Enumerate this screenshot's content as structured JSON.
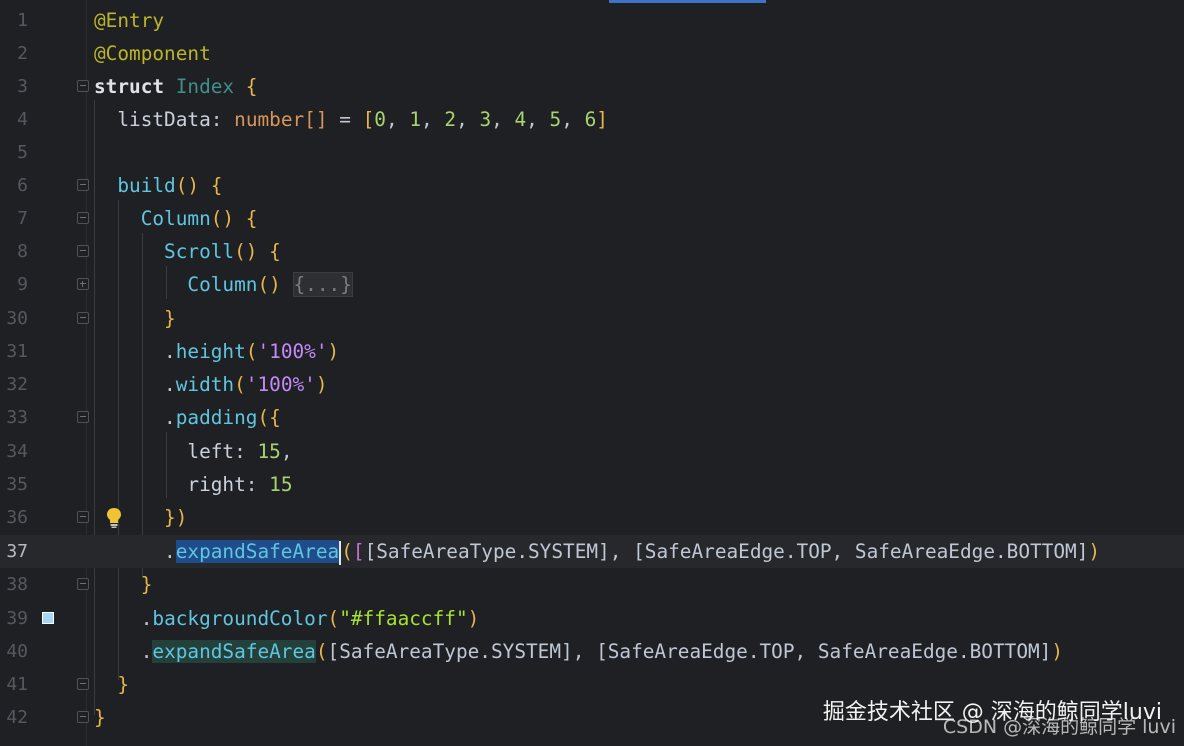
{
  "editor": {
    "accent": "#3d72c8",
    "current_line": "37",
    "lines": [
      {
        "n": "1"
      },
      {
        "n": "2"
      },
      {
        "n": "3"
      },
      {
        "n": "4"
      },
      {
        "n": "5"
      },
      {
        "n": "6"
      },
      {
        "n": "7"
      },
      {
        "n": "8"
      },
      {
        "n": "9"
      },
      {
        "n": "30"
      },
      {
        "n": "31"
      },
      {
        "n": "32"
      },
      {
        "n": "33"
      },
      {
        "n": "34"
      },
      {
        "n": "35"
      },
      {
        "n": "36"
      },
      {
        "n": "37"
      },
      {
        "n": "38"
      },
      {
        "n": "39"
      },
      {
        "n": "40"
      },
      {
        "n": "41"
      },
      {
        "n": "42"
      }
    ],
    "code": {
      "l1": "@Entry",
      "l2": "@Component",
      "l3_kw": "struct",
      "l3_name": "Index",
      "l3_brace": "{",
      "l4_prop": "listData",
      "l4_colon": ":",
      "l4_type": "number[]",
      "l4_eq": "=",
      "l4_open": "[",
      "l4_nums": [
        "0",
        "1",
        "2",
        "3",
        "4",
        "5",
        "6"
      ],
      "l4_close": "]",
      "l6_fn": "build",
      "l6_rest": "() {",
      "l7_fn": "Column",
      "l7_rest": "() {",
      "l8_fn": "Scroll",
      "l8_rest": "() {",
      "l9_fn": "Column",
      "l9_rest": "()",
      "l9_folded": "{...}",
      "l30": "}",
      "l31_dot": ".",
      "l31_fn": "height",
      "l31_arg": "'100%'",
      "l32_dot": ".",
      "l32_fn": "width",
      "l32_arg": "'100%'",
      "l33_dot": ".",
      "l33_fn": "padding",
      "l33_rest": "({",
      "l34_key": "left",
      "l34_val": "15",
      "l35_key": "right",
      "l35_val": "15",
      "l36": "})",
      "l37_dot": ".",
      "l37_fn": "expandSafeArea",
      "l37_args_a": "[SafeAreaType.SYSTEM]",
      "l37_args_b": "[SafeAreaEdge.TOP, SafeAreaEdge.BOTTOM]",
      "l38": "}",
      "l39_dot": ".",
      "l39_fn": "backgroundColor",
      "l39_arg": "\"#ffaaccff\"",
      "l40_dot": ".",
      "l40_fn": "expandSafeArea",
      "l40_args_a": "[SafeAreaType.SYSTEM]",
      "l40_args_b": "[SafeAreaEdge.TOP, SafeAreaEdge.BOTTOM]",
      "l41": "}",
      "l42": "}"
    },
    "swatch_color": "#ffaaccff",
    "icons": {
      "fold_open": "fold-collapse-icon",
      "fold_closed": "fold-expand-icon",
      "bulb": "lightbulb-intention-icon",
      "swatch": "color-swatch-icon"
    }
  },
  "watermark": {
    "line1": "掘金技术社区 @ 深海的鲸同学luvi",
    "line2": "CSDN @深海的鲸同学 luvi"
  }
}
